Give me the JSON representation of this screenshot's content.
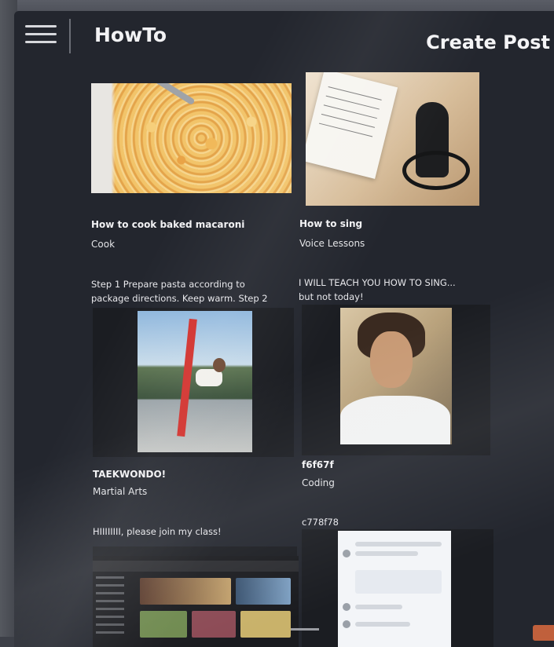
{
  "header": {
    "app_title": "HowTo",
    "create_post_label": "Create Post",
    "menu_icon": "hamburger-menu-icon"
  },
  "posts": [
    {
      "title": "How to cook baked macaroni",
      "category": "Cook",
      "description_lines": [
        "Step 1 Prepare pasta according to",
        "package directions. Keep warm. Step 2"
      ],
      "image": "baked-macaroni-photo"
    },
    {
      "title": "How to sing",
      "category": "Voice Lessons",
      "description_lines": [
        "I WILL TEACH YOU HOW TO SING...",
        "but not today!"
      ],
      "image": "microphone-photo"
    },
    {
      "title": "TAEKWONDO!",
      "category": "Martial Arts",
      "description_lines": [
        "HIIIIIIII, please join my class!"
      ],
      "image": "taekwondo-kick-photo"
    },
    {
      "title": "f6f67f",
      "category": "Coding",
      "description_lines": [
        "c778f78"
      ],
      "image": "portrait-photo"
    }
  ],
  "more_images": [
    "video-site-screenshot",
    "chat-app-screenshot"
  ]
}
